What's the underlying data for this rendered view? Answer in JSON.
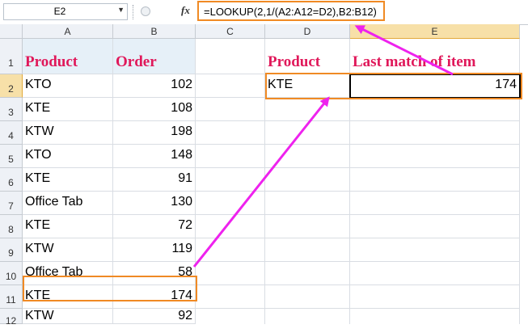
{
  "formula_bar": {
    "name_box": "E2",
    "fx_symbol": "fx",
    "formula": "=LOOKUP(2,1/(A2:A12=D2),B2:B12)"
  },
  "columns": [
    "A",
    "B",
    "C",
    "D",
    "E"
  ],
  "rows": [
    "1",
    "2",
    "3",
    "4",
    "5",
    "6",
    "7",
    "8",
    "9",
    "10",
    "11",
    "12"
  ],
  "headers": {
    "product": "Product",
    "order": "Order",
    "lookup_product": "Product",
    "last_match": "Last match of item"
  },
  "data": [
    {
      "product": "KTO",
      "order": "102"
    },
    {
      "product": "KTE",
      "order": "108"
    },
    {
      "product": "KTW",
      "order": "198"
    },
    {
      "product": "KTO",
      "order": "148"
    },
    {
      "product": "KTE",
      "order": "91"
    },
    {
      "product": "Office Tab",
      "order": "130"
    },
    {
      "product": "KTE",
      "order": "72"
    },
    {
      "product": "KTW",
      "order": "119"
    },
    {
      "product": "Office Tab",
      "order": "58"
    },
    {
      "product": "KTE",
      "order": "174"
    },
    {
      "product": "KTW",
      "order": "92"
    }
  ],
  "lookup": {
    "value": "KTE",
    "result": "174"
  },
  "colors": {
    "highlight": "#f08a24",
    "arrow": "#ee22ee",
    "header_text": "#e0185a",
    "header_fill": "#e6f0f8"
  },
  "icons": {
    "name_box_dropdown": "chevron-down-icon",
    "function": "fx-icon",
    "formula_bar_separator": "circle-icon"
  }
}
